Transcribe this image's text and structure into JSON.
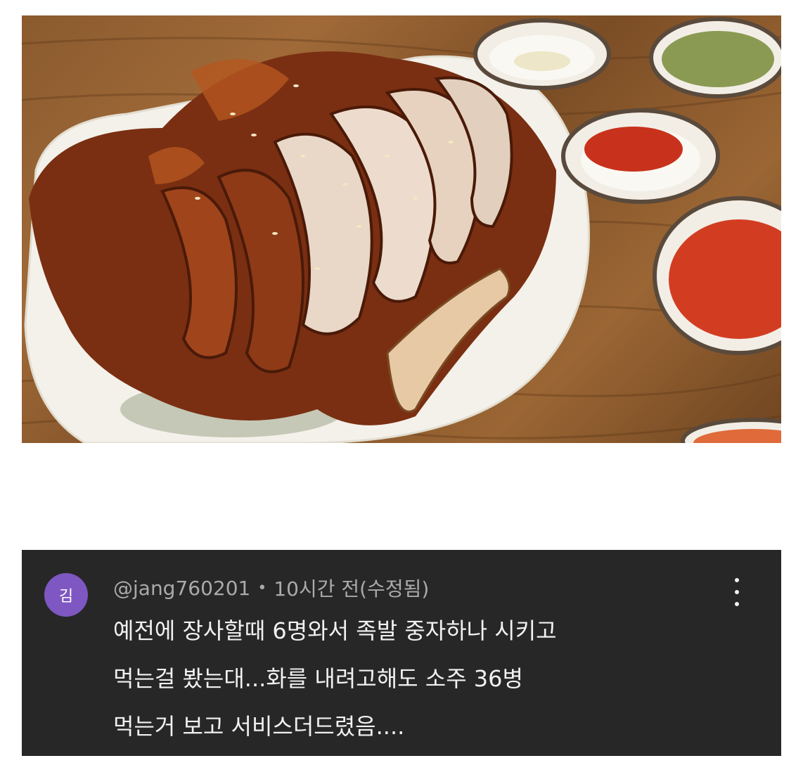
{
  "photo": {
    "alt_subject": "jokbal-photo"
  },
  "comment": {
    "avatar_letter": "김",
    "avatar_color": "#7e57c2",
    "username": "@jang760201",
    "separator": "•",
    "timestamp": "10시간 전(수정됨)",
    "text_lines": [
      "예전에 장사할때 6명와서 족발 중자하나 시키고",
      "먹는걸 봤는대...화를 내려고해도 소주 36병",
      "먹는거 보고  서비스더드렸음...."
    ],
    "background": "#272727"
  }
}
